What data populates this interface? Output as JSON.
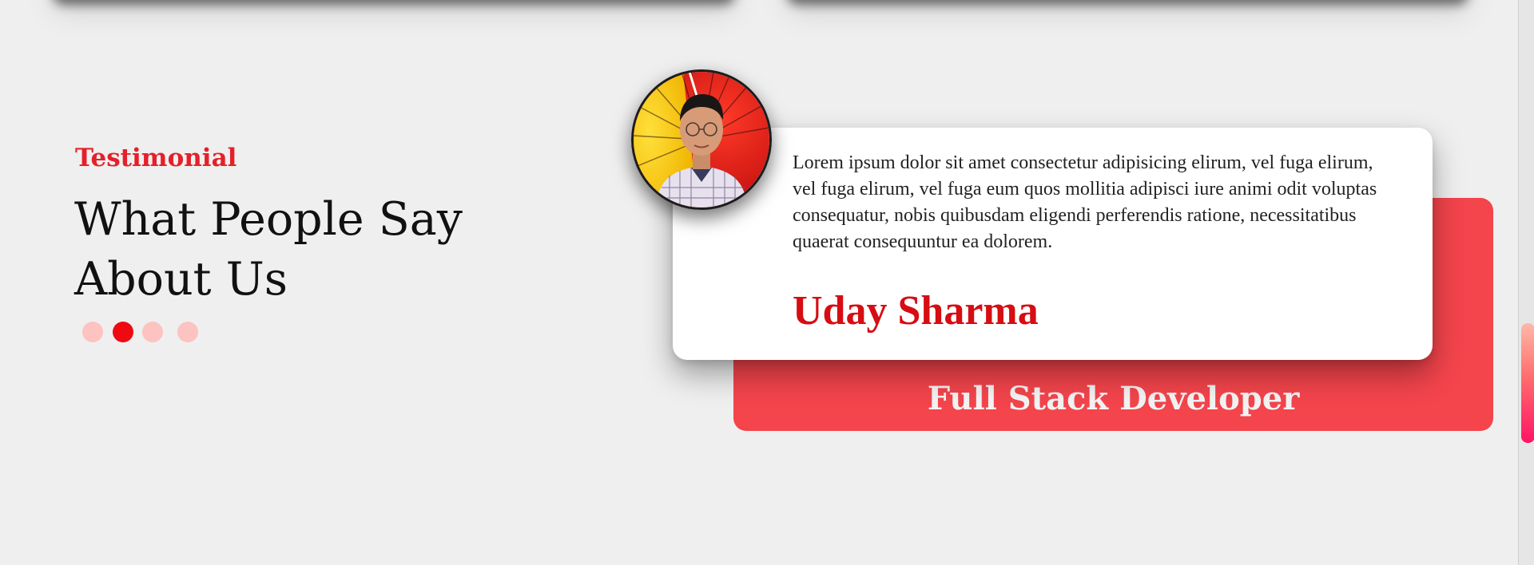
{
  "testimonial": {
    "eyebrow": "Testimonial",
    "heading_line1": "What People Say",
    "heading_line2": "About Us",
    "carousel": {
      "count": 4,
      "active_index": 1
    },
    "card": {
      "quote": "Lorem ipsum dolor sit amet consectetur adipisicing elirum, vel fuga elirum, vel fuga elirum, vel fuga eum quos mollitia adipisci iure animi odit voluptas consequatur, nobis quibusdam eligendi perferendis ratione, necessitatibus quaerat consequuntur ea dolorem.",
      "name": "Uday Sharma",
      "role": "Full Stack Developer"
    }
  },
  "colors": {
    "accent": "#e4202a",
    "name": "#d60d12",
    "back_card": "#f4444c",
    "dot_active": "#ee0a10",
    "dot_inactive": "#fdc3c0",
    "background": "#efefef"
  },
  "icons": {
    "avatar": "person-photo"
  }
}
